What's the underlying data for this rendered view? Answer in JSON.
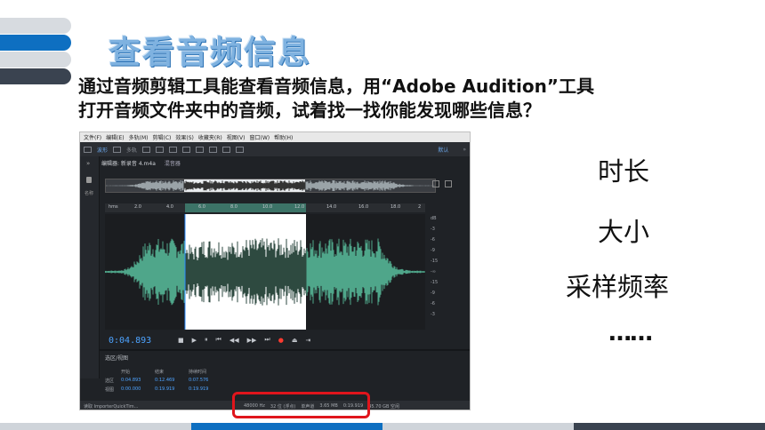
{
  "slide": {
    "title": "查看音频信息",
    "intro_line1": "通过音频剪辑工具能查看音频信息，用“Adobe Audition”工具",
    "intro_line2": "打开音频文件夹中的音频，试着找一找你能发现哪些信息？"
  },
  "info_list": [
    "时长",
    "大小",
    "采样频率",
    "……"
  ],
  "audition": {
    "menu": [
      "文件(F)",
      "编辑(E)",
      "多轨(M)",
      "剪辑(C)",
      "效果(S)",
      "收藏夹(R)",
      "视图(V)",
      "窗口(W)",
      "帮助(H)"
    ],
    "toolbar": {
      "waveform_label": "波形",
      "multitrack_label": "多轨",
      "default_label": "默认",
      "more_label": "»"
    },
    "left_panel": {
      "collapse": "»",
      "label": "名称"
    },
    "editor_tabs": {
      "editor": "编辑器: 新录音 4.m4a",
      "mixer": "混音器"
    },
    "ruler": {
      "unit": "hms",
      "ticks": [
        "2.0",
        "4.0",
        "6.0",
        "8.0",
        "10.0",
        "12.0",
        "14.0",
        "16.0",
        "18.0",
        "2"
      ]
    },
    "db_labels": [
      "dB",
      "-3",
      "-6",
      "-9",
      "-15",
      "-∞",
      "-15",
      "-9",
      "-6",
      "-3"
    ],
    "current_time": "0:04.893",
    "transport": [
      "■",
      "▶",
      "⏸",
      "⏮",
      "◀◀",
      "▶▶",
      "⏭",
      "●",
      "⏏",
      "⇥"
    ],
    "selection_view": {
      "title": "选区/视图",
      "headers": [
        "",
        "开始",
        "结束",
        "持续时间"
      ],
      "rows": [
        {
          "label": "选区",
          "start": "0:04.893",
          "end": "0:12.469",
          "duration": "0:07.576"
        },
        {
          "label": "视图",
          "start": "0:00.000",
          "end": "0:19.919",
          "duration": "0:19.919"
        }
      ]
    },
    "status": {
      "left": "读取 ImporterQuickTim...",
      "sample_rate": "48000 Hz",
      "bits": "32 位 (浮点)",
      "channels": "单声道",
      "size": "3.65 MB",
      "duration": "0:19.919",
      "free": "45.70 GB 空闲"
    }
  },
  "colors": {
    "title": "#7fb2e0",
    "accent_blue": "#0e6fc1",
    "wave_green": "#4fa68a",
    "highlight_red": "#e0151c"
  }
}
